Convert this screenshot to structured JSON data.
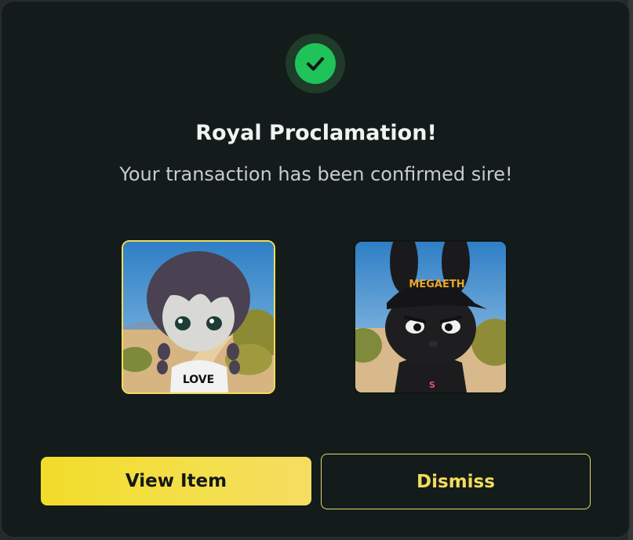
{
  "modal": {
    "title": "Royal Proclamation!",
    "message": "Your transaction has been confirmed sire!",
    "status_icon": "check-circle-icon",
    "success_color": "#1fc35a"
  },
  "items": [
    {
      "name": "nft-image-girl",
      "selected": true,
      "caption": "LOVE"
    },
    {
      "name": "nft-image-bunny",
      "selected": false,
      "caption": "MEGAETH"
    }
  ],
  "actions": {
    "view_label": "View Item",
    "dismiss_label": "Dismiss"
  },
  "colors": {
    "accent": "#f3dc5a",
    "background": "#131b1b",
    "text": "#f1f3f2"
  }
}
